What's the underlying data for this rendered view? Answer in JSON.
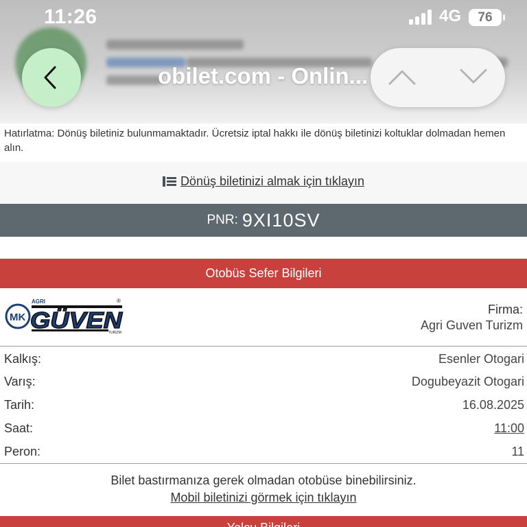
{
  "status_bar": {
    "time": "11:26",
    "network": "4G",
    "battery": "76"
  },
  "browser": {
    "page_title": "obilet.com - Onlin...",
    "back_icon": "chevron-left-icon",
    "prev_icon": "chevron-up-icon",
    "next_icon": "chevron-down-icon"
  },
  "reminder": "Hatırlatma: Dönüş biletiniz bulunmamaktadır. Ücretsiz iptal hakkı ile dönüş biletinizi koltuklar dolmadan hemen alın.",
  "return_link": {
    "icon": "list-icon",
    "label": "Dönüş biletinizi almak için tıklayın"
  },
  "pnr": {
    "label": "PNR:",
    "code": "9XI10SV"
  },
  "trip_section": {
    "header": "Otobüs Sefer Bilgileri",
    "logo": {
      "prefix": "MK",
      "top_text": "AGRI",
      "main_text": "GÜVEN",
      "sub_text": "TURİZM"
    },
    "firm_label": "Firma:",
    "firm_name": "Agri Guven Turizm",
    "rows": [
      {
        "label": "Kalkış:",
        "value": "Esenler Otogari"
      },
      {
        "label": "Varış:",
        "value": "Dogubeyazit Otogari"
      },
      {
        "label": "Tarih:",
        "value": "16.08.2025"
      },
      {
        "label": "Saat:",
        "value": "11:00"
      },
      {
        "label": "Peron:",
        "value": "11"
      }
    ],
    "board_message": "Bilet bastırmanıza gerek olmadan otobüse binebilirsiniz.",
    "mobile_link": "Mobil biletinizi görmek için tıklayın"
  },
  "next_section_header": "Yolcu Bilgileri",
  "colors": {
    "accent_red": "#c9413d",
    "pnr_bar": "#5d686f",
    "back_button": "#c5efc8"
  }
}
